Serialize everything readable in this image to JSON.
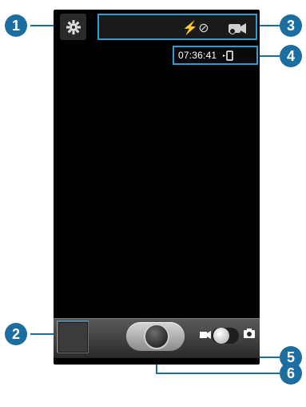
{
  "callouts": [
    "1",
    "2",
    "3",
    "4",
    "5",
    "6"
  ],
  "status": {
    "time": "07:36:41"
  },
  "icons": {
    "settings": "gear-icon",
    "flash": "flash-off-icon",
    "mode": "camera-mode-icon",
    "storage": "phone-storage-icon",
    "video": "video-camera-icon",
    "photo": "photo-camera-icon"
  },
  "flash_glyph": "⚡⊘",
  "colors": {
    "callout": "#1c6ea0",
    "highlight": "#2f9cd6",
    "screen": "#000000"
  }
}
